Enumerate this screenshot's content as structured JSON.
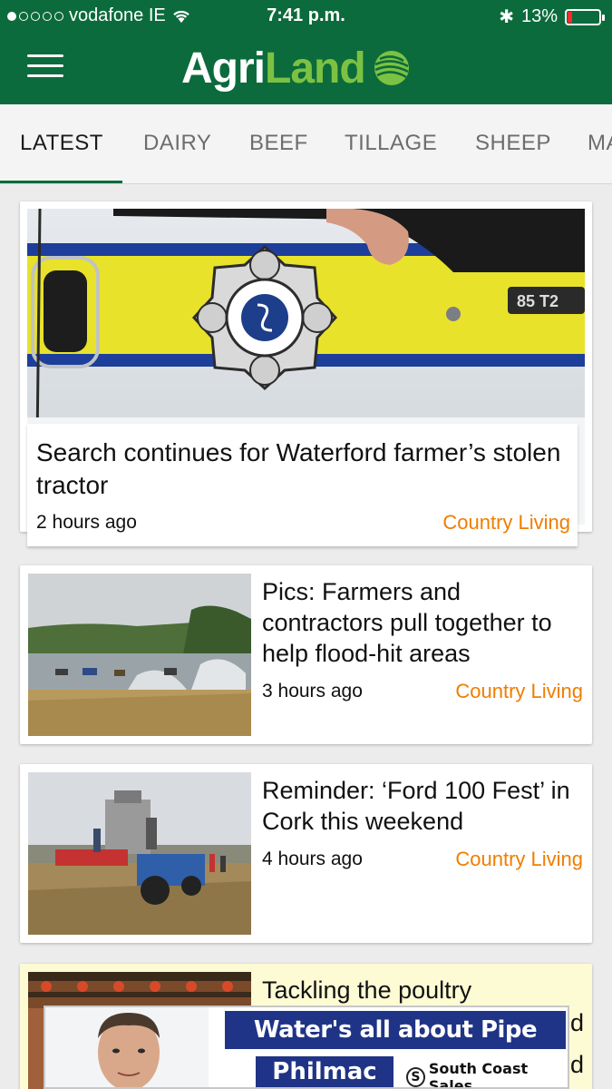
{
  "status_bar": {
    "carrier": "vodafone IE",
    "time": "7:41 p.m.",
    "battery": "13%",
    "battery_level": 0.13,
    "signal_bars": 1
  },
  "app": {
    "logo_part1": "Agri",
    "logo_part2": "Land",
    "brand_green": "#0c6b3c",
    "brand_lime": "#7cc242"
  },
  "tabs": [
    {
      "label": "LATEST",
      "active": true
    },
    {
      "label": "DAIRY"
    },
    {
      "label": "BEEF"
    },
    {
      "label": "TILLAGE"
    },
    {
      "label": "SHEEP"
    },
    {
      "label": "MA"
    }
  ],
  "articles": [
    {
      "title": "Search continues for Waterford farmer’s stolen tractor",
      "time": "2 hours ago",
      "category": "Country Living"
    },
    {
      "title": "Pics: Farmers and contractors pull together to help flood-hit areas",
      "time": "3 hours ago",
      "category": "Country Living"
    },
    {
      "title": "Reminder: ‘Ford 100 Fest’ in Cork this weekend",
      "time": "4 hours ago",
      "category": "Country Living"
    },
    {
      "title": "Tackling the poultry",
      "title_fragment": "d",
      "title_fragment2": "d"
    }
  ],
  "ad": {
    "slogan": "Water's all about Pipe Size",
    "brand": "Philmac",
    "dealer": "South Coast Sales"
  },
  "colors": {
    "category": "#f07d00",
    "ad_blue": "#1f3486"
  }
}
